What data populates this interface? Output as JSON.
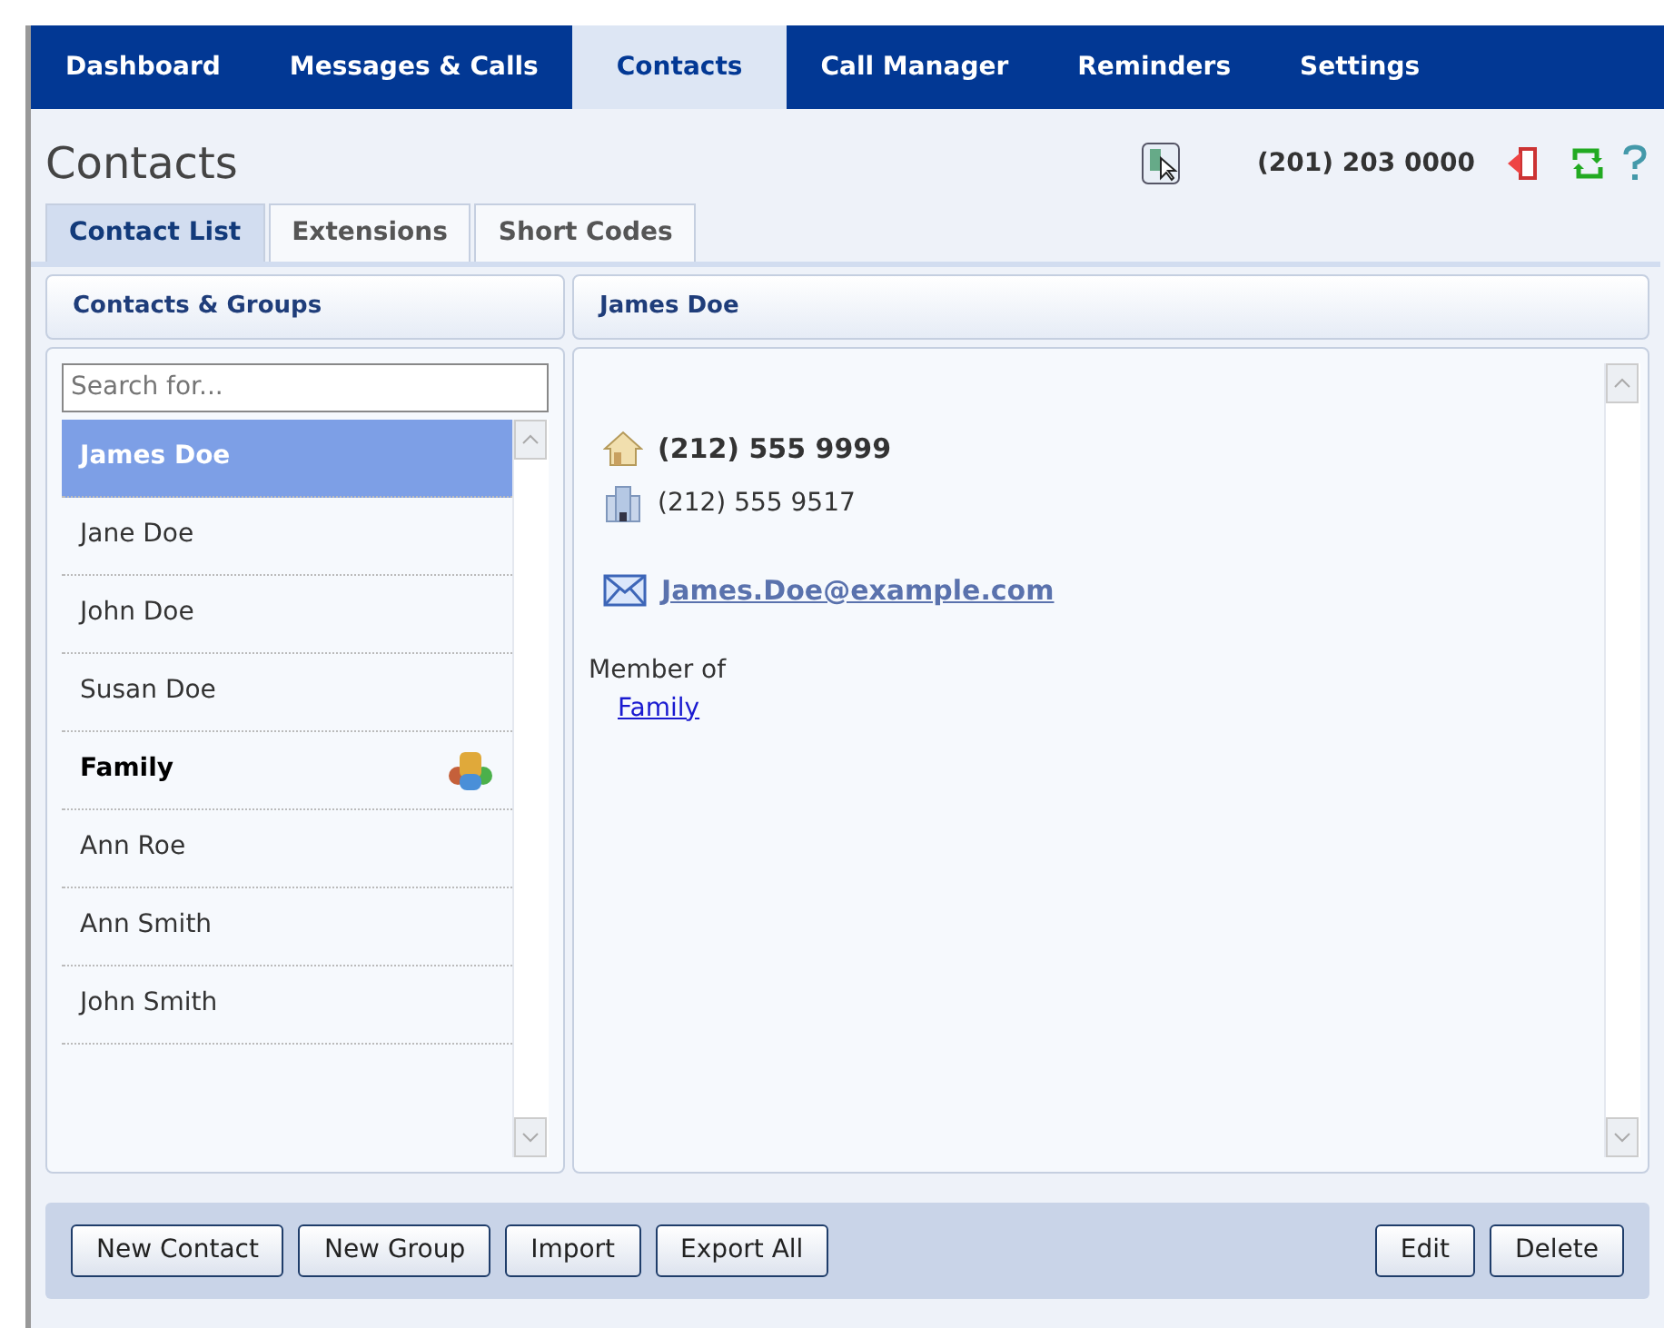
{
  "nav_tabs": [
    {
      "label": "Dashboard",
      "selected": false
    },
    {
      "label": "Messages & Calls",
      "selected": false
    },
    {
      "label": "Contacts",
      "selected": true
    },
    {
      "label": "Call Manager",
      "selected": false
    },
    {
      "label": "Reminders",
      "selected": false
    },
    {
      "label": "Settings",
      "selected": false
    }
  ],
  "page_title": "Contacts",
  "phone_number": "(201) 203 0000",
  "sub_tabs": [
    {
      "label": "Contact List",
      "selected": true
    },
    {
      "label": "Extensions",
      "selected": false
    },
    {
      "label": "Short Codes",
      "selected": false
    }
  ],
  "list_panel": {
    "title": "Contacts & Groups",
    "search": {
      "placeholder": "Search for..."
    },
    "items": [
      {
        "label": "James Doe",
        "kind": "contact",
        "selected": true
      },
      {
        "label": "Jane Doe",
        "kind": "contact",
        "selected": false
      },
      {
        "label": "John Doe",
        "kind": "contact",
        "selected": false
      },
      {
        "label": "Susan Doe",
        "kind": "contact",
        "selected": false
      },
      {
        "label": "Family",
        "kind": "group",
        "selected": false
      },
      {
        "label": "Ann Roe",
        "kind": "contact",
        "selected": false
      },
      {
        "label": "Ann Smith",
        "kind": "contact",
        "selected": false
      },
      {
        "label": "John Smith",
        "kind": "contact",
        "selected": false
      }
    ]
  },
  "detail_panel": {
    "title": "James Doe",
    "phones": [
      {
        "kind": "home",
        "number": "(212) 555 9999",
        "primary": true
      },
      {
        "kind": "work",
        "number": "(212) 555 9517",
        "primary": false
      }
    ],
    "email": "James.Doe@example.com",
    "member_label": "Member of",
    "groups": [
      "Family"
    ]
  },
  "buttons_left": [
    "New Contact",
    "New Group",
    "Import",
    "Export All"
  ],
  "buttons_right": [
    "Edit",
    "Delete"
  ]
}
